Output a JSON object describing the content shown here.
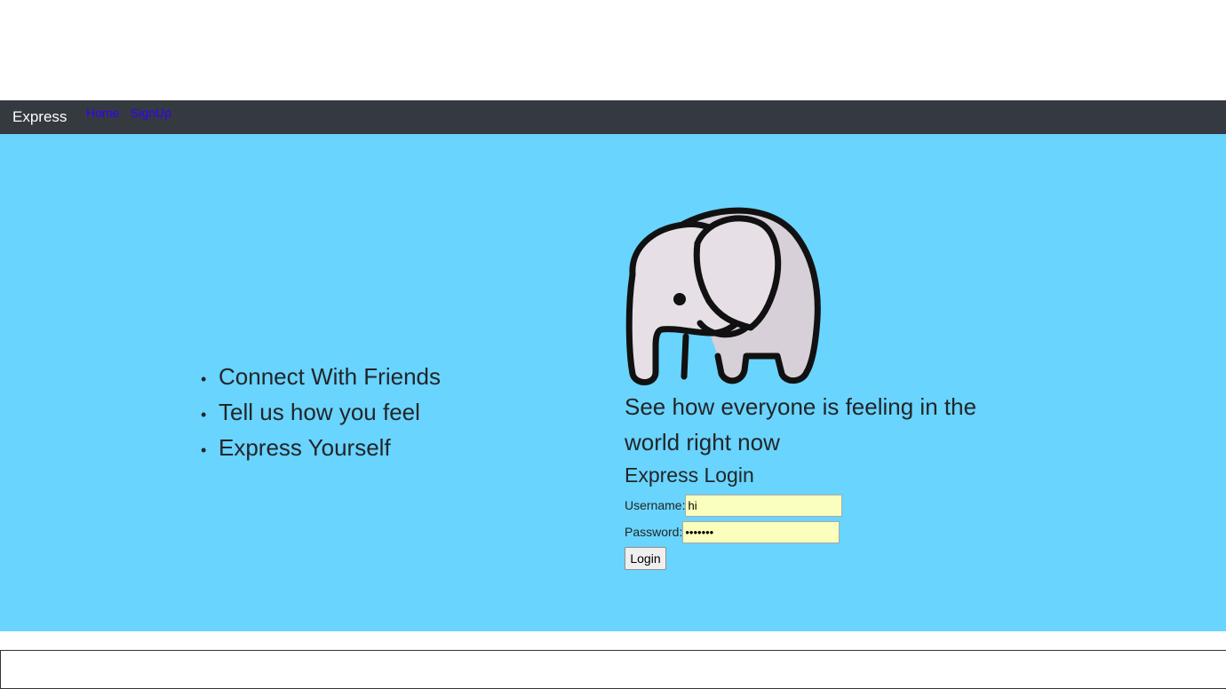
{
  "navbar": {
    "brand": "Express",
    "links": [
      "Home",
      "SignUp"
    ],
    "background": "#343a40",
    "link_color": "#3300ff"
  },
  "hero": {
    "background": "#69d4fd",
    "features": [
      "Connect With Friends",
      "Tell us how you feel",
      "Express Yourself"
    ],
    "tagline": "See how everyone is feeling in the world right now",
    "illustration": "elephant-icon"
  },
  "login": {
    "title": "Express Login",
    "username_label": "Username:",
    "username_value": "hi",
    "password_label": "Password:",
    "password_value": "•••••••",
    "button_label": "Login",
    "input_background": "#faffbd"
  }
}
